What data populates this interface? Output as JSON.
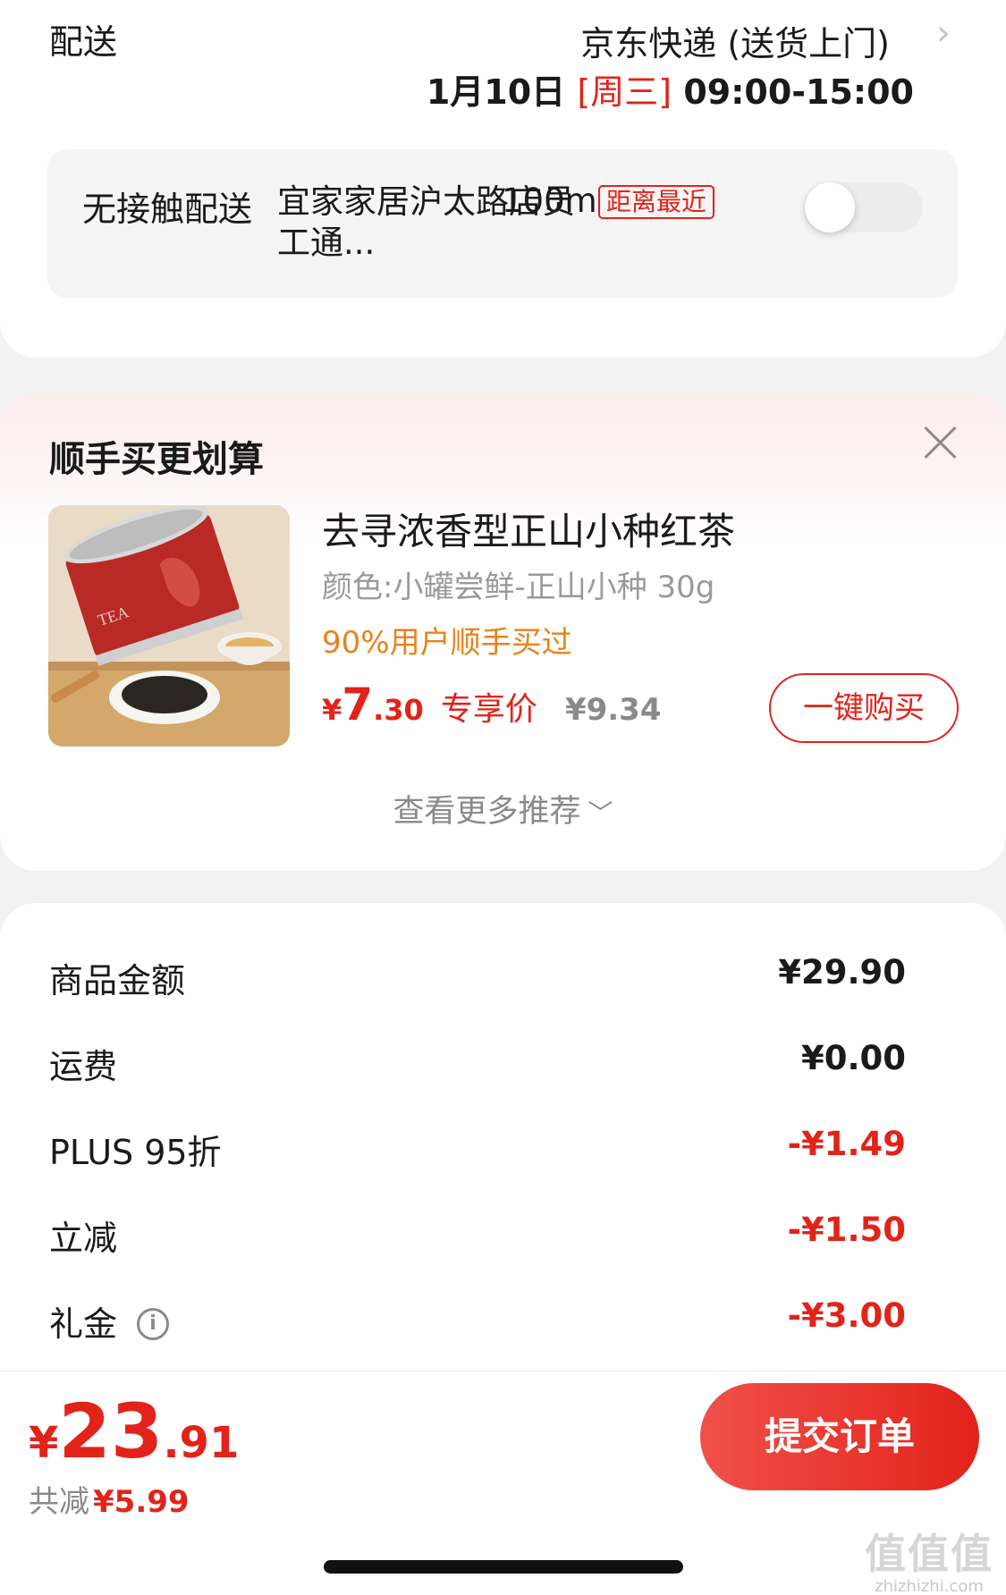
{
  "delivery": {
    "label": "配送",
    "method": "京东快递 (送货上门)",
    "date": "1月10日",
    "weekday": "[周三]",
    "time_window": "09:00-15:00",
    "contactless_label": "无接触配送",
    "store": "宜家家居沪太路店员工通...",
    "distance": "100m",
    "distance_tag": "距离最近",
    "contactless_enabled": false
  },
  "recommend": {
    "title": "顺手买更划算",
    "product": {
      "name": "去寻浓香型正山小种红茶",
      "spec": "颜色:小罐尝鲜-正山小种 30g",
      "social_proof": "90%用户顺手买过",
      "price_symbol": "¥",
      "price_int": "7",
      "price_dec": ".30",
      "price_label": "专享价",
      "original_price": "¥9.34",
      "image_text": "TEA"
    },
    "buy_button": "一键购买",
    "more_label": "查看更多推荐"
  },
  "summary": {
    "rows": [
      {
        "label": "商品金额",
        "value": "¥29.90",
        "negative": false
      },
      {
        "label": "运费",
        "value": "¥0.00",
        "negative": false
      },
      {
        "label": "PLUS 95折",
        "value": "-¥1.49",
        "negative": true
      },
      {
        "label": "立减",
        "value": "-¥1.50",
        "negative": true
      },
      {
        "label": "礼金",
        "value": "-¥3.00",
        "negative": true
      }
    ]
  },
  "footer": {
    "total_symbol": "¥",
    "total_int": "23",
    "total_dec": ".91",
    "saved_label": "共减",
    "saved_amount": "¥5.99",
    "submit_label": "提交订单",
    "watermark_top": "值值值",
    "watermark_bottom": "zhizhizhi.com"
  },
  "colors": {
    "accent_red": "#e2231a",
    "orange": "#e8831c",
    "muted_gray": "#8a8a8a",
    "page_bg": "#f2f2f2"
  }
}
